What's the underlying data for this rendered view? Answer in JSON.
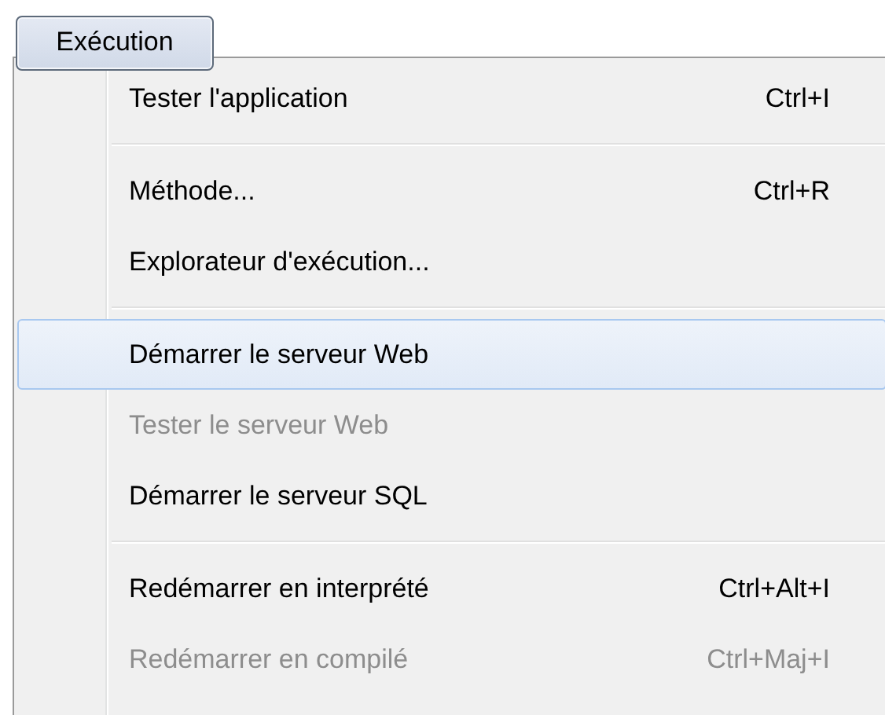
{
  "menu_bar": {
    "title": "Exécution"
  },
  "menu": {
    "items": [
      {
        "kind": "item",
        "label": "Tester l'application",
        "shortcut": "Ctrl+I",
        "disabled": false,
        "selected": false
      },
      {
        "kind": "separator"
      },
      {
        "kind": "item",
        "label": "Méthode...",
        "shortcut": "Ctrl+R",
        "disabled": false,
        "selected": false
      },
      {
        "kind": "item",
        "label": "Explorateur d'exécution...",
        "disabled": false,
        "selected": false
      },
      {
        "kind": "separator"
      },
      {
        "kind": "item",
        "label": "Démarrer le serveur Web",
        "disabled": false,
        "selected": true
      },
      {
        "kind": "item",
        "label": "Tester le serveur Web",
        "disabled": true,
        "selected": false
      },
      {
        "kind": "item",
        "label": "Démarrer le serveur SQL",
        "disabled": false,
        "selected": false
      },
      {
        "kind": "separator"
      },
      {
        "kind": "item",
        "label": "Redémarrer en interprété",
        "shortcut": "Ctrl+Alt+I",
        "disabled": false,
        "selected": false
      },
      {
        "kind": "item",
        "label": "Redémarrer en compilé",
        "shortcut": "Ctrl+Maj+I",
        "disabled": true,
        "selected": false
      }
    ]
  }
}
